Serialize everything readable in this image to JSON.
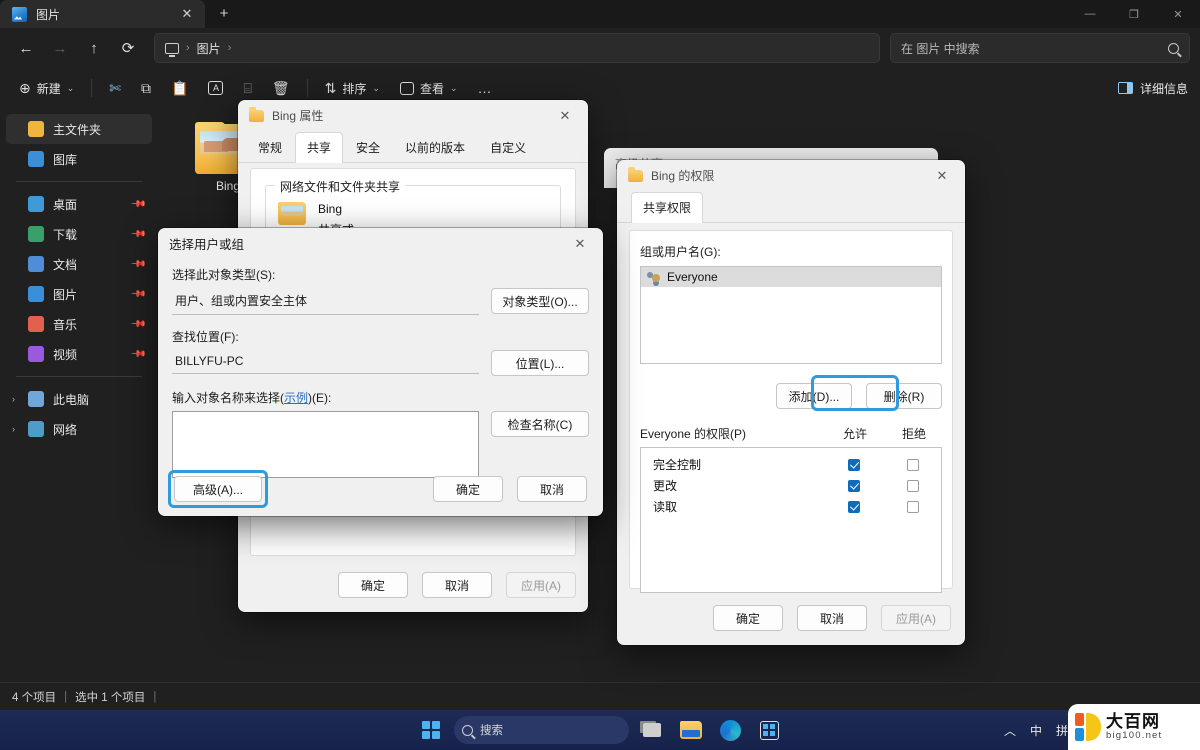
{
  "explorer": {
    "tab": {
      "title": "图片",
      "close_label": "✕",
      "newtab_label": "+"
    },
    "window_controls": {
      "minimize": "—",
      "maximize": "❐",
      "close": "✕"
    },
    "nav": {
      "back": "←",
      "forward": "→",
      "up": "↑",
      "refresh": "⟳"
    },
    "breadcrumb": {
      "sep": "›",
      "items": [
        "图片"
      ]
    },
    "search": {
      "placeholder": "在 图片 中搜索"
    },
    "toolbar": {
      "new_label": "新建",
      "new_caret": "⌄",
      "cut_icon": "✄",
      "copy_icon": "⧉",
      "paste_icon": "📋",
      "rename_icon": "A",
      "share_icon": "⌸",
      "delete_icon": "🗑",
      "sort_label": "排序",
      "sort_caret": "⌄",
      "view_label": "查看",
      "view_caret": "⌄",
      "more_label": "…",
      "details_label": "详细信息"
    },
    "sidebar": {
      "items": [
        {
          "label": "主文件夹",
          "icon": "home-icon",
          "color": "#f0b53c",
          "selected": true,
          "pinned": false,
          "chevron": ""
        },
        {
          "label": "图库",
          "icon": "gallery-icon",
          "color": "#3b8fd8",
          "selected": false,
          "pinned": false,
          "chevron": ""
        },
        {
          "label": "桌面",
          "icon": "desktop-icon",
          "color": "#3f9ad8",
          "selected": false,
          "pinned": true,
          "chevron": ""
        },
        {
          "label": "下载",
          "icon": "downloads-icon",
          "color": "#3aa06a",
          "selected": false,
          "pinned": true,
          "chevron": ""
        },
        {
          "label": "文档",
          "icon": "documents-icon",
          "color": "#4f8ed6",
          "selected": false,
          "pinned": true,
          "chevron": ""
        },
        {
          "label": "图片",
          "icon": "pictures-icon",
          "color": "#3b8fd8",
          "selected": false,
          "pinned": true,
          "chevron": ""
        },
        {
          "label": "音乐",
          "icon": "music-icon",
          "color": "#e0614f",
          "selected": false,
          "pinned": true,
          "chevron": ""
        },
        {
          "label": "视频",
          "icon": "videos-icon",
          "color": "#9a5ade",
          "selected": false,
          "pinned": true,
          "chevron": ""
        },
        {
          "label": "此电脑",
          "icon": "this-pc-icon",
          "color": "#6fa8d8",
          "selected": false,
          "pinned": false,
          "chevron": "›"
        },
        {
          "label": "网络",
          "icon": "network-icon",
          "color": "#4e9cc8",
          "selected": false,
          "pinned": false,
          "chevron": "›"
        }
      ]
    },
    "content": {
      "folder_name": "Bing"
    },
    "statusbar": {
      "count": "4 个项目",
      "sep1": "|",
      "selected": "选中 1 个项目",
      "sep2": "|"
    }
  },
  "properties_dialog": {
    "title": "Bing 属性",
    "close": "✕",
    "tabs": [
      {
        "label": "常规",
        "active": false
      },
      {
        "label": "共享",
        "active": true
      },
      {
        "label": "安全",
        "active": false
      },
      {
        "label": "以前的版本",
        "active": false
      },
      {
        "label": "自定义",
        "active": false
      }
    ],
    "group_label": "网络文件和文件夹共享",
    "share_name": "Bing",
    "share_state": "共享式",
    "buttons": {
      "ok": "确定",
      "cancel": "取消",
      "apply": "应用(A)"
    }
  },
  "advanced_sharing_window": {
    "title": "高级共享",
    "caret": "⌄"
  },
  "select_users_dialog": {
    "title": "选择用户或组",
    "close": "✕",
    "object_type_label": "选择此对象类型(S):",
    "object_type_value": "用户、组或内置安全主体",
    "object_type_button": "对象类型(O)...",
    "location_label": "查找位置(F):",
    "location_value": "BILLYFU-PC",
    "location_button": "位置(L)...",
    "names_label_pre": "输入对象名称来选择(",
    "names_label_link": "示例",
    "names_label_post": ")(E):",
    "names_value": "",
    "check_names_button": "检查名称(C)",
    "advanced_button": "高级(A)...",
    "ok_button": "确定",
    "cancel_button": "取消",
    "highlighted": "advanced-button"
  },
  "permissions_dialog": {
    "title": "Bing 的权限",
    "close": "✕",
    "tabs": [
      {
        "label": "共享权限",
        "active": true
      }
    ],
    "group_users_label": "组或用户名(G):",
    "group_users": [
      {
        "name": "Everyone",
        "selected": true
      }
    ],
    "add_button": "添加(D)...",
    "remove_button": "删除(R)",
    "permissions_label": "Everyone 的权限(P)",
    "col_allow": "允许",
    "col_deny": "拒绝",
    "permission_rows": [
      {
        "name": "完全控制",
        "allow": true,
        "deny": false
      },
      {
        "name": "更改",
        "allow": true,
        "deny": false
      },
      {
        "name": "读取",
        "allow": true,
        "deny": false
      }
    ],
    "buttons": {
      "ok": "确定",
      "cancel": "取消",
      "apply": "应用(A)"
    },
    "highlighted": "add-button"
  },
  "taskbar": {
    "search_placeholder": "搜索",
    "items": [
      {
        "name": "start-button",
        "label": ""
      },
      {
        "name": "search-box",
        "label": "搜索"
      },
      {
        "name": "task-view-button",
        "label": ""
      },
      {
        "name": "file-explorer-button",
        "label": ""
      },
      {
        "name": "edge-button",
        "label": ""
      },
      {
        "name": "store-button",
        "label": ""
      }
    ],
    "tray": {
      "overflow": "︿",
      "ime_mode": "中",
      "ime_method": "拼"
    },
    "watermark": {
      "title": "大百网",
      "url": "big100.net"
    }
  },
  "colors": {
    "accent": "#2e9ae0",
    "checkbox_on": "#0f6cbd",
    "dialog_bg": "#f0f0f0",
    "explorer_bg": "#202020",
    "taskbar_bg": "#1d2b55"
  }
}
